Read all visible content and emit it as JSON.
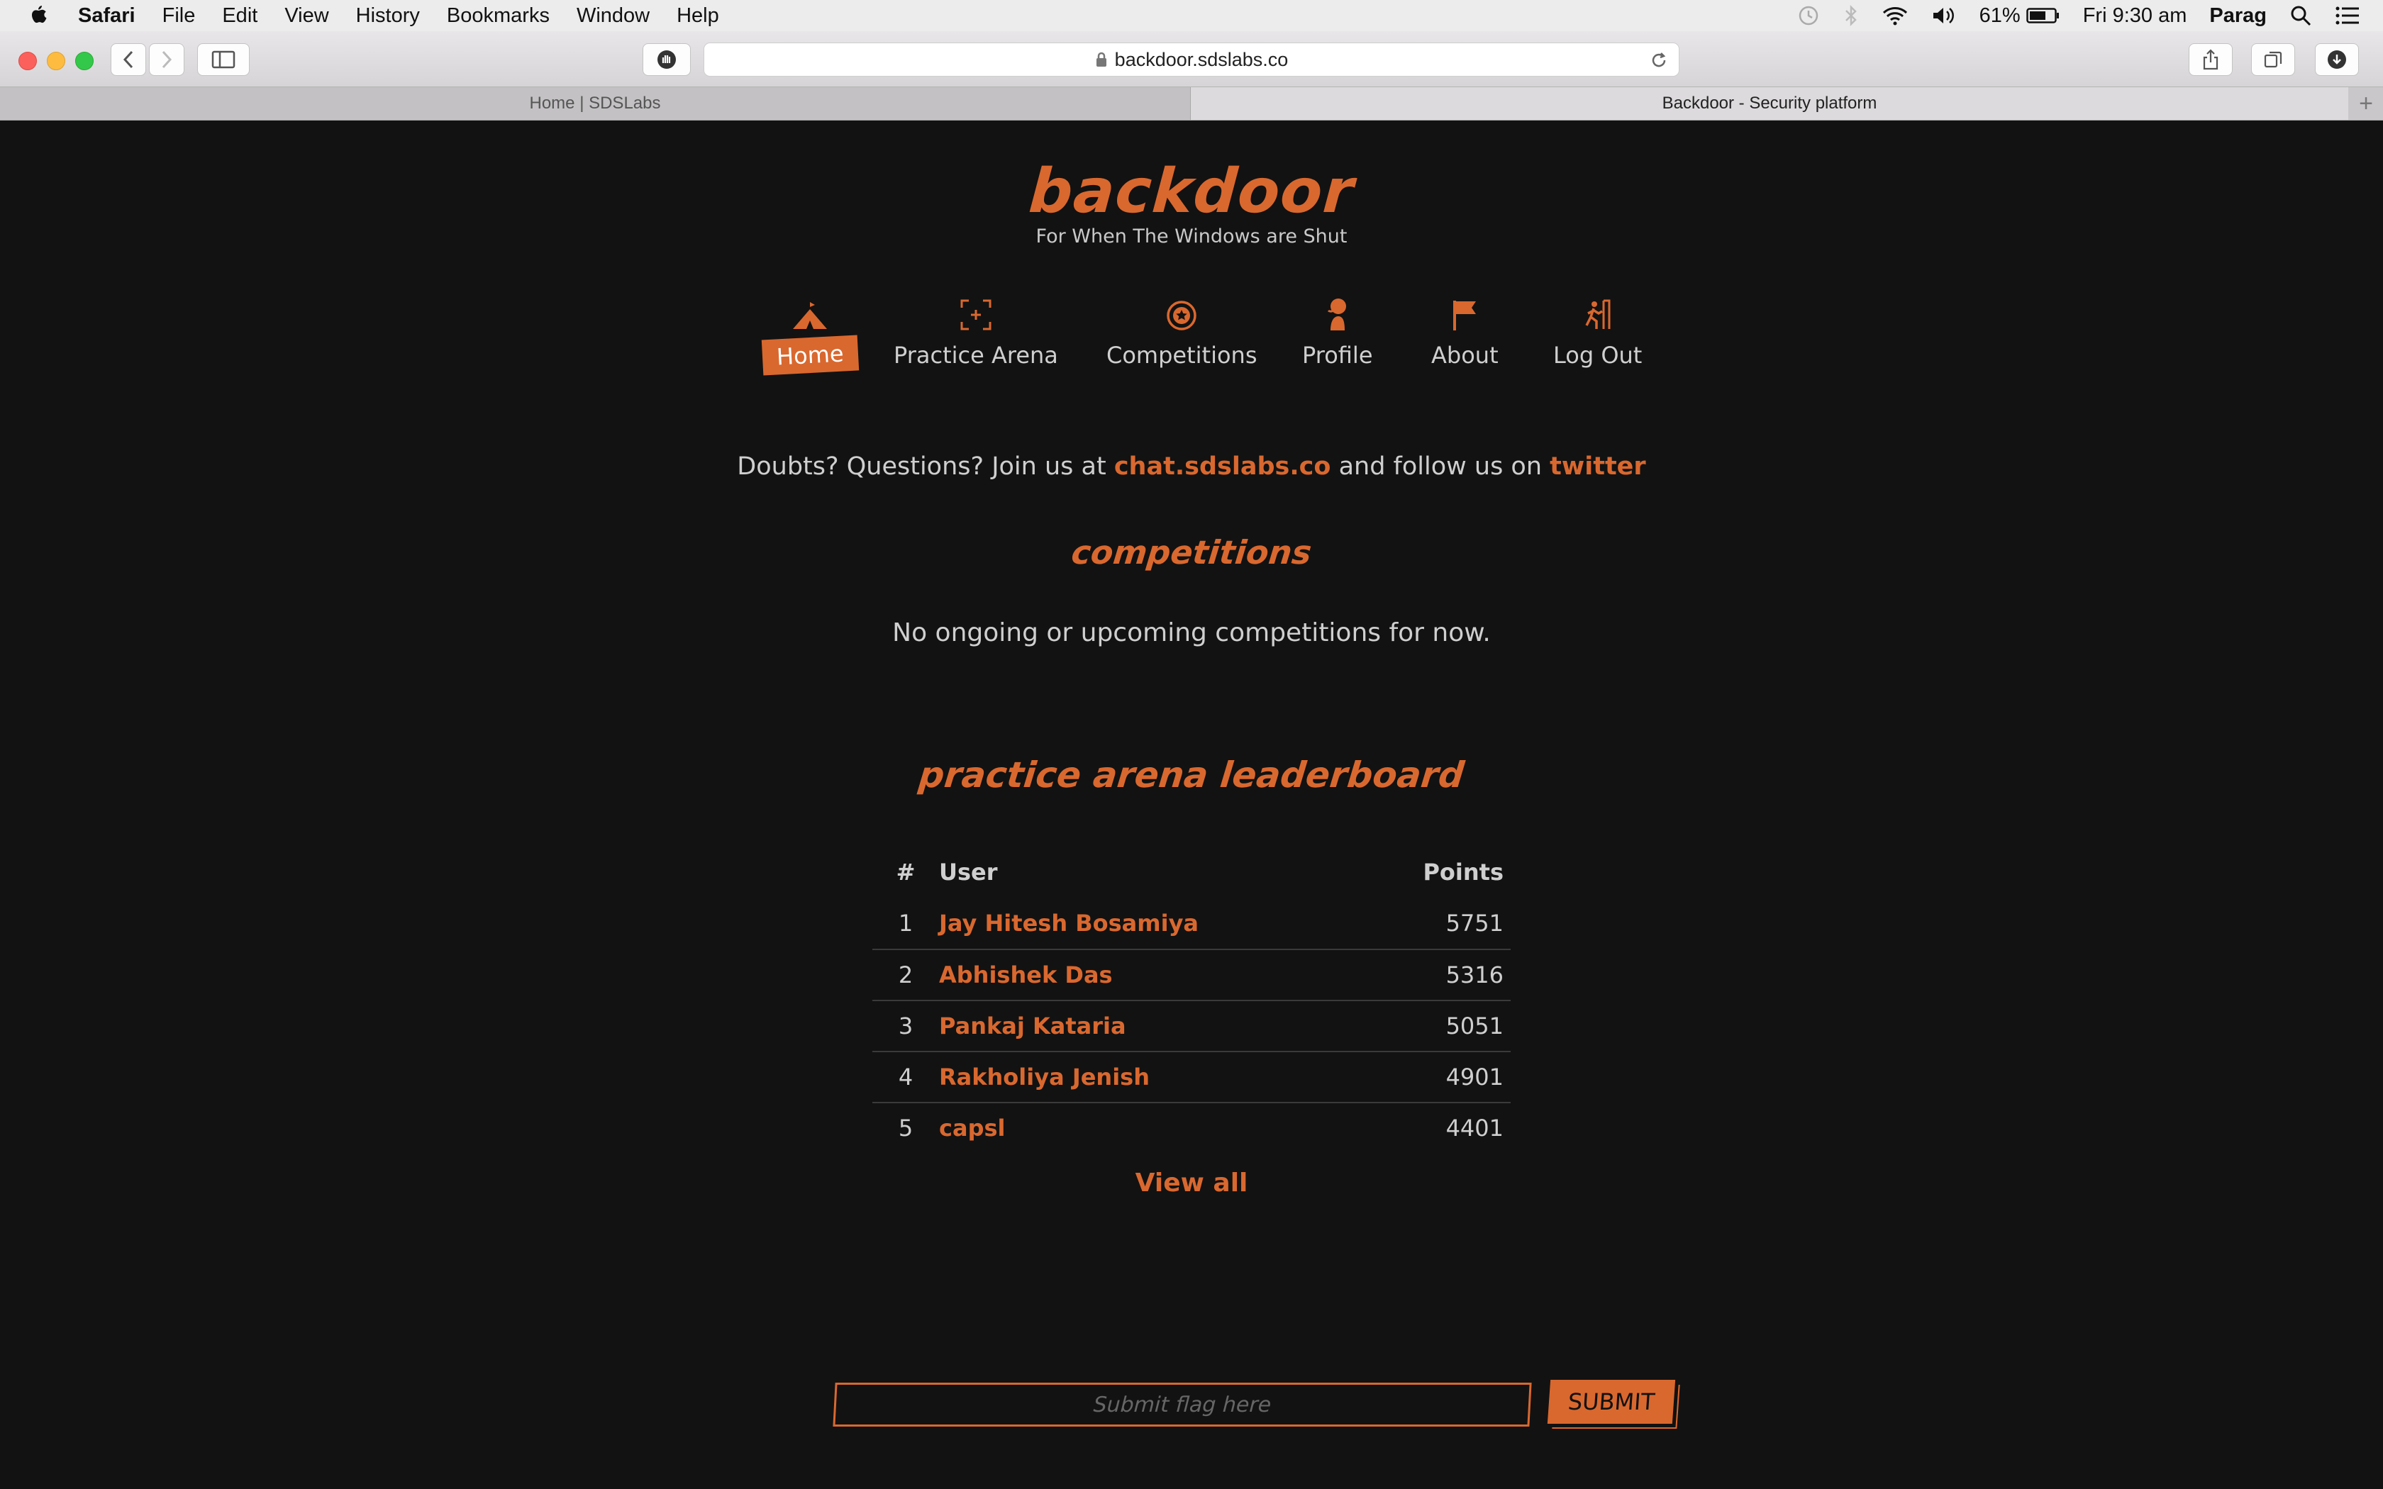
{
  "menubar": {
    "app_name": "Safari",
    "menus": [
      "File",
      "Edit",
      "View",
      "History",
      "Bookmarks",
      "Window",
      "Help"
    ],
    "battery": "61%",
    "clock": "Fri 9:30 am",
    "user": "Parag"
  },
  "browser": {
    "url": "backdoor.sdslabs.co",
    "tabs": [
      {
        "title": "Home | SDSLabs"
      },
      {
        "title": "Backdoor - Security platform"
      }
    ]
  },
  "site": {
    "logo": "backdoor",
    "tagline": "For When The Windows are Shut",
    "nav": [
      {
        "label": "Home",
        "icon": "home-tent-icon"
      },
      {
        "label": "Practice Arena",
        "icon": "target-icon"
      },
      {
        "label": "Competitions",
        "icon": "medal-icon"
      },
      {
        "label": "Profile",
        "icon": "profile-icon"
      },
      {
        "label": "About",
        "icon": "flag-icon"
      },
      {
        "label": "Log Out",
        "icon": "exit-icon"
      }
    ],
    "doubts": {
      "prefix": "Doubts? Questions? Join us at ",
      "chat_link": "chat.sdslabs.co",
      "middle": " and follow us on ",
      "twitter_link": "twitter"
    },
    "competitions_heading": "competitions",
    "competitions_empty": "No ongoing or upcoming competitions for now.",
    "leaderboard_heading": "practice arena leaderboard",
    "leaderboard": {
      "headers": {
        "rank": "#",
        "user": "User",
        "points": "Points"
      },
      "rows": [
        {
          "rank": "1",
          "user": "Jay Hitesh Bosamiya",
          "points": "5751"
        },
        {
          "rank": "2",
          "user": "Abhishek Das",
          "points": "5316"
        },
        {
          "rank": "3",
          "user": "Pankaj Kataria",
          "points": "5051"
        },
        {
          "rank": "4",
          "user": "Rakholiya Jenish",
          "points": "4901"
        },
        {
          "rank": "5",
          "user": "capsl",
          "points": "4401"
        }
      ]
    },
    "view_all": "View all",
    "flag_placeholder": "Submit flag here",
    "submit_label": "SUBMIT"
  },
  "colors": {
    "accent": "#d9682f",
    "background": "#121212"
  }
}
